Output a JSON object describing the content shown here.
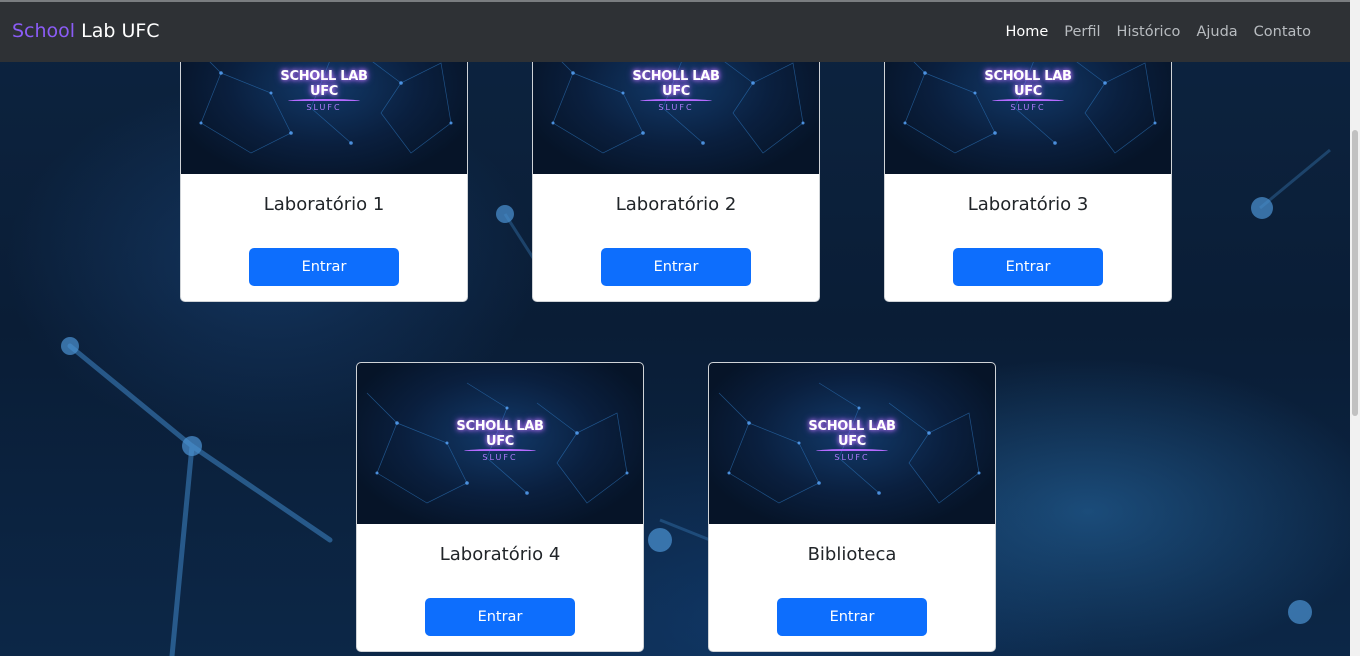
{
  "navbar": {
    "brand_accent": "School",
    "brand_rest": " Lab UFC",
    "links": [
      "Home",
      "Perfil",
      "Histórico",
      "Ajuda",
      "Contato"
    ]
  },
  "logo": {
    "line1": "SCHOLL LAB",
    "line2": "UFC",
    "line3": "SLUFC"
  },
  "cards": [
    {
      "title": "Laboratório 1",
      "button": "Entrar"
    },
    {
      "title": "Laboratório 2",
      "button": "Entrar"
    },
    {
      "title": "Laboratório 3",
      "button": "Entrar"
    },
    {
      "title": "Laboratório 4",
      "button": "Entrar"
    },
    {
      "title": "Biblioteca",
      "button": "Entrar"
    }
  ],
  "colors": {
    "navbar_bg": "#2e3135",
    "brand_accent": "#8b5cf6",
    "button": "#0d6efd",
    "background": "#0d2440"
  }
}
